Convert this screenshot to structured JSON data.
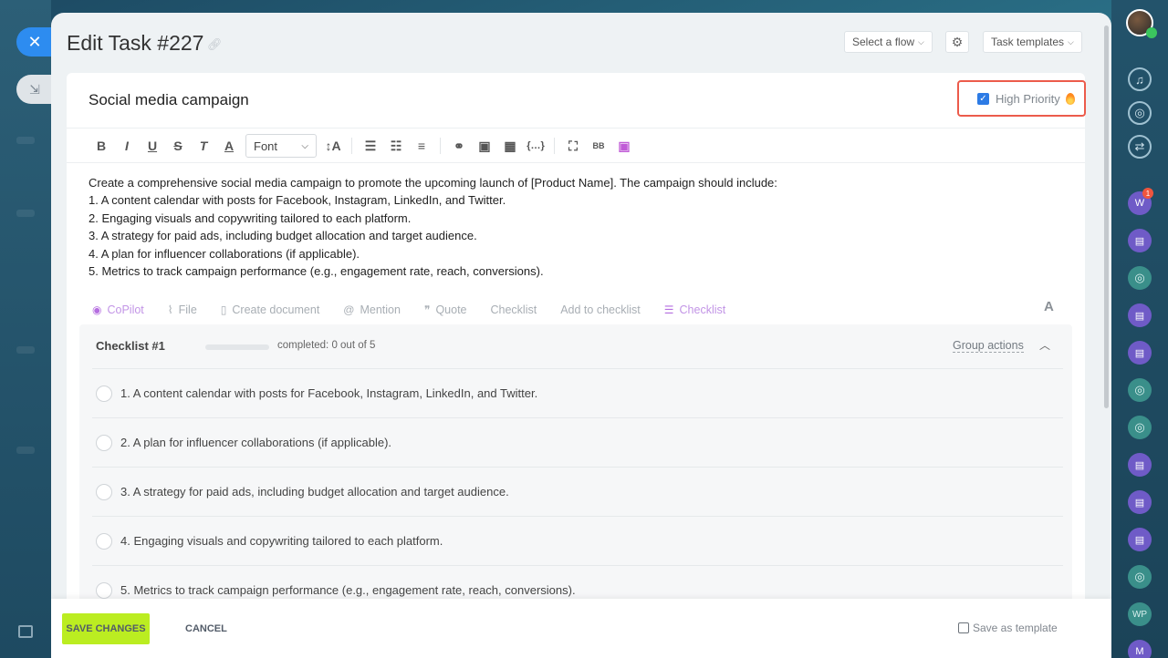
{
  "header": {
    "title": "Edit Task #227",
    "flow_select": "Select a flow",
    "task_templates": "Task templates"
  },
  "task": {
    "title": "Social media campaign",
    "high_priority_label": "High Priority",
    "high_priority_checked": true
  },
  "editor": {
    "font_label": "Font",
    "description": [
      "Create a comprehensive social media campaign to promote the upcoming launch of [Product Name]. The campaign should include:",
      "1. A content calendar with posts for Facebook, Instagram, LinkedIn, and Twitter.",
      "2. Engaging visuals and copywriting tailored to each platform.",
      "3. A strategy for paid ads, including budget allocation and target audience.",
      "4. A plan for influencer collaborations (if applicable).",
      "5. Metrics to track campaign performance (e.g., engagement rate, reach, conversions)."
    ]
  },
  "actions": {
    "copilot": "CoPilot",
    "file": "File",
    "create_document": "Create document",
    "mention": "Mention",
    "quote": "Quote",
    "checklist": "Checklist",
    "add_to_checklist": "Add to checklist",
    "checklist2": "Checklist",
    "font_a": "A"
  },
  "checklist": {
    "title": "Checklist #1",
    "completed_text": "completed: 0 out of 5",
    "progress_fraction": 0,
    "group_actions": "Group actions",
    "items": [
      "1. A content calendar with posts for Facebook, Instagram, LinkedIn, and Twitter.",
      "2. A plan for influencer collaborations (if applicable).",
      "3. A strategy for paid ads, including budget allocation and target audience.",
      "4. Engaging visuals and copywriting tailored to each platform.",
      "5. Metrics to track campaign performance (e.g., engagement rate, reach, conversions)."
    ]
  },
  "footer": {
    "save": "SAVE CHANGES",
    "cancel": "CANCEL",
    "save_template": "Save as template",
    "save_template_checked": false
  },
  "right_bar": {
    "avatar_w": "W",
    "badge": "1",
    "wp": "WP",
    "m": "M"
  },
  "colors": {
    "accent_blue": "#2d8cf0",
    "save_green": "#bbed21",
    "priority_border": "#ec5b4b",
    "copilot_purple": "#b56ee0"
  }
}
